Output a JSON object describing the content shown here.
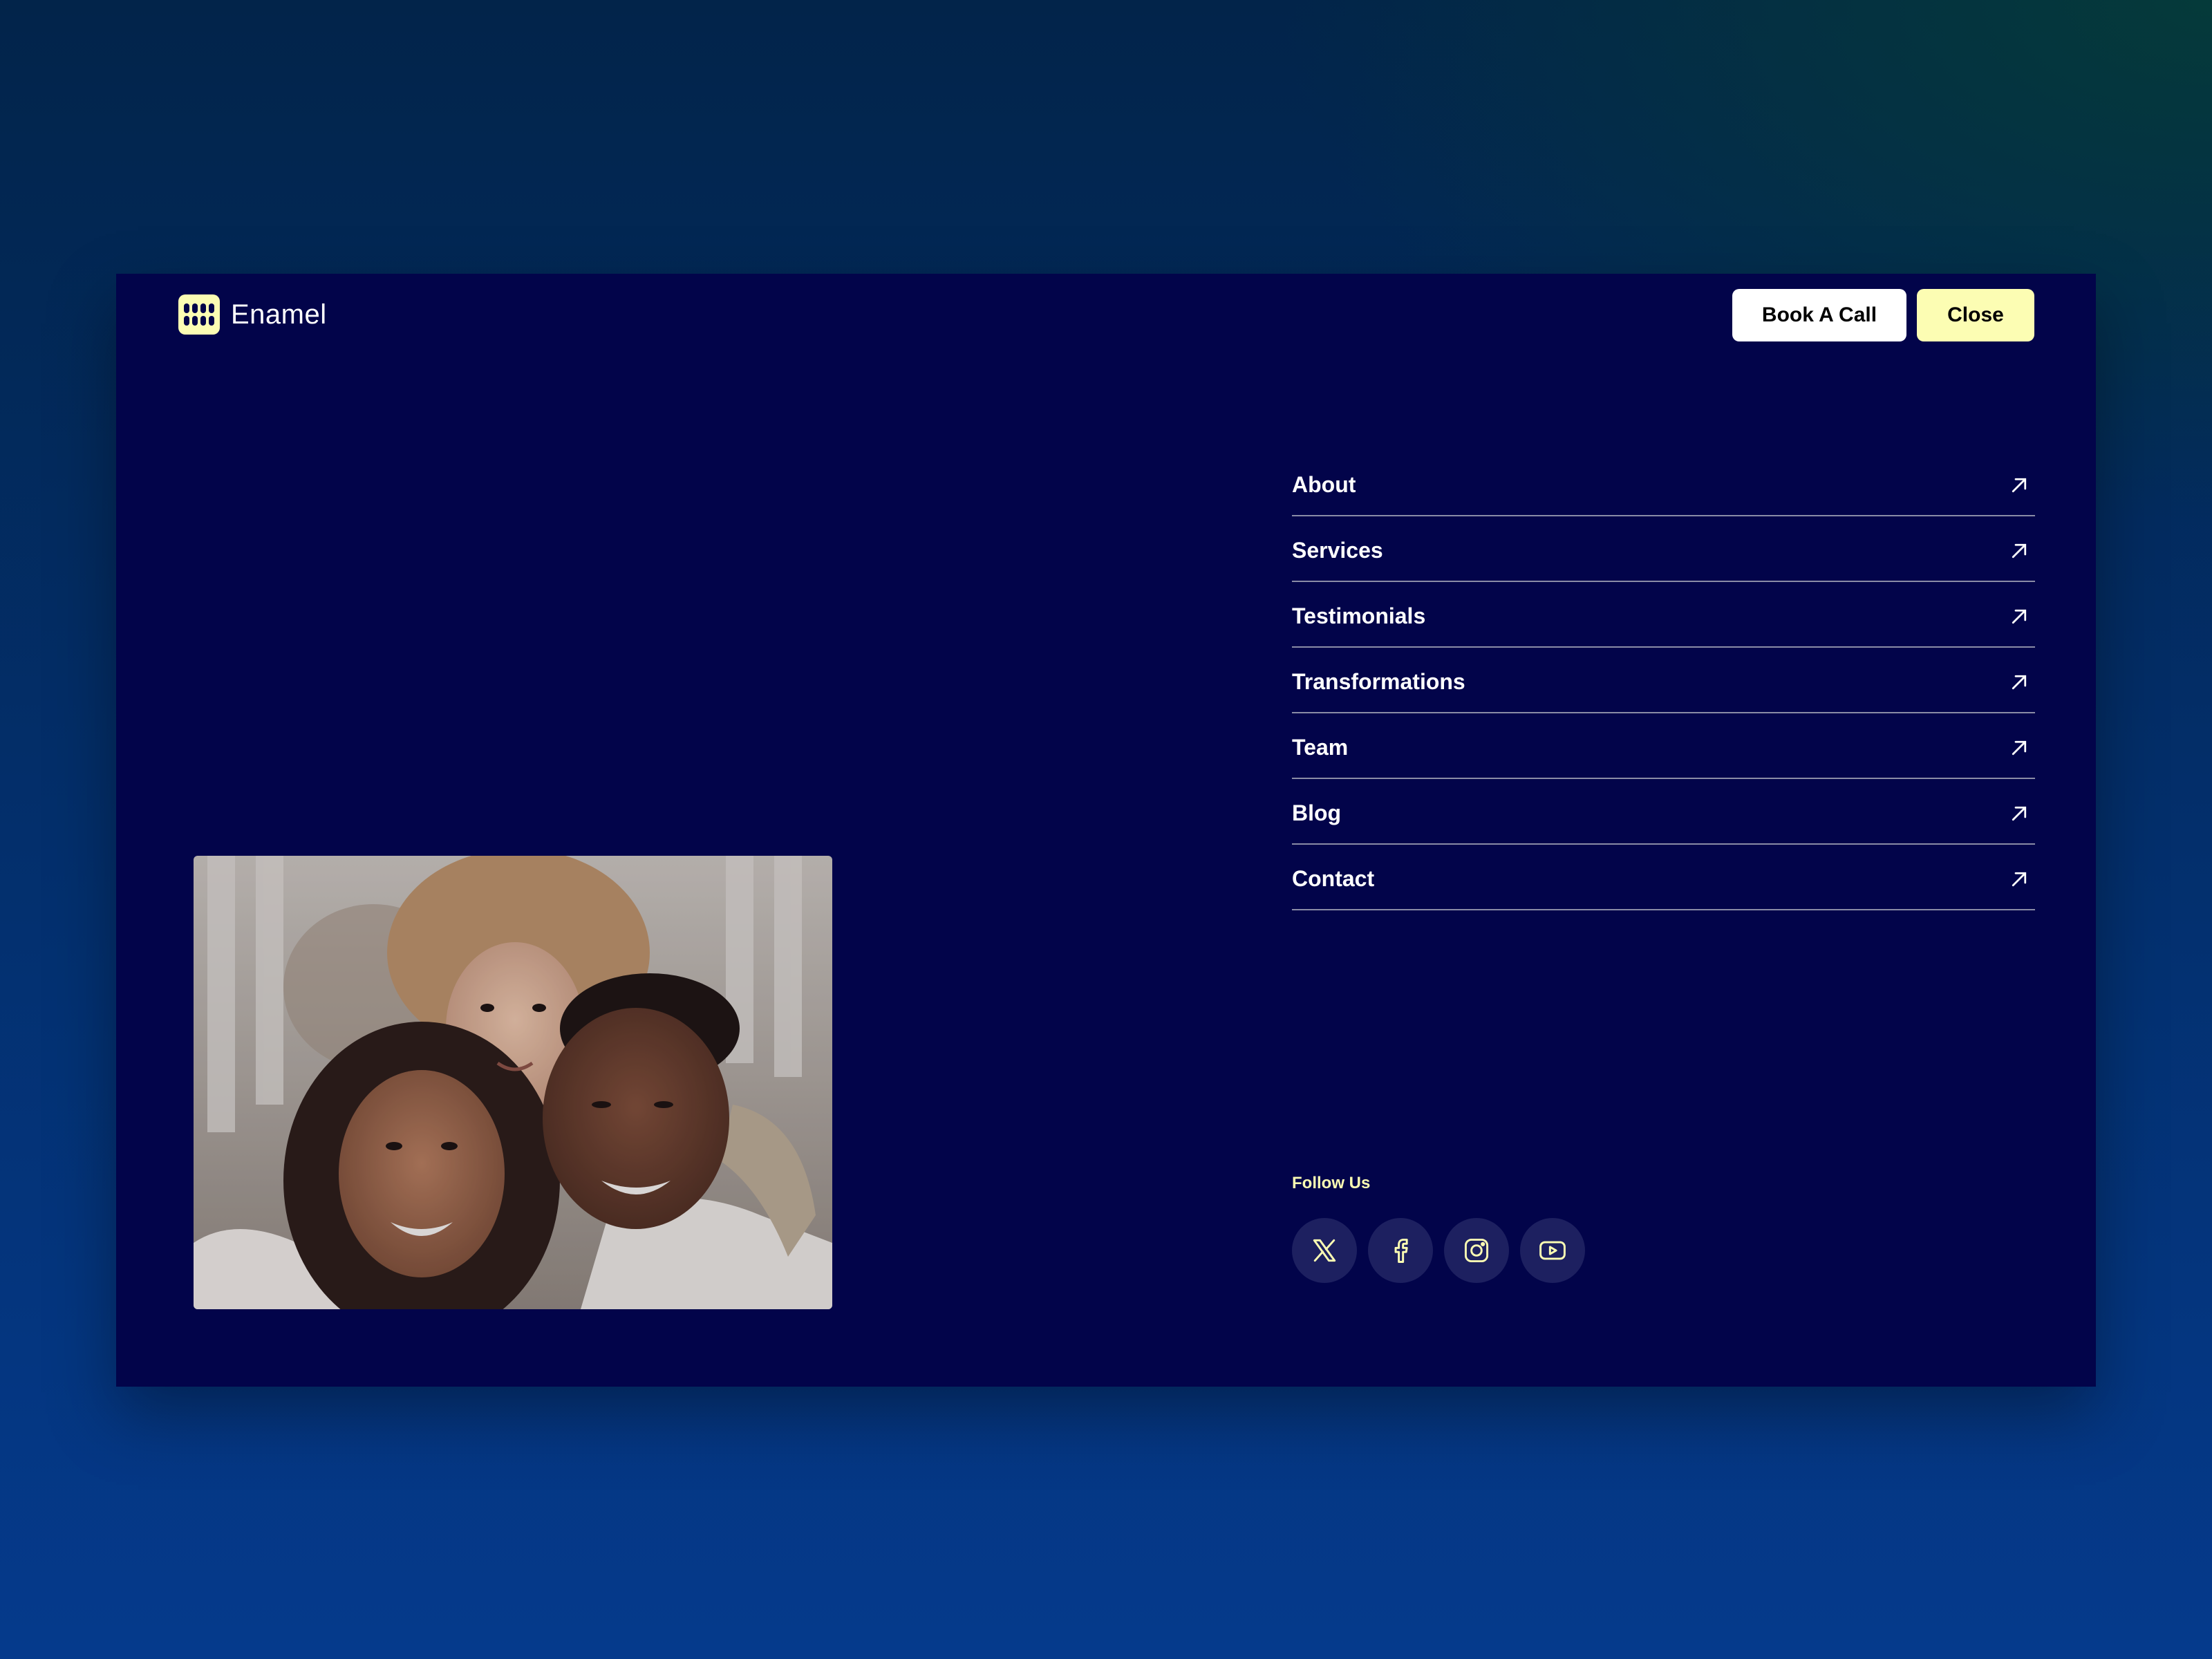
{
  "brand": {
    "name": "Enamel",
    "icon": "teeth-grid-icon"
  },
  "header": {
    "book_label": "Book A Call",
    "close_label": "Close"
  },
  "nav": {
    "items": [
      {
        "label": "About",
        "icon": "arrow-up-right-icon"
      },
      {
        "label": "Services",
        "icon": "arrow-up-right-icon"
      },
      {
        "label": "Testimonials",
        "icon": "arrow-up-right-icon"
      },
      {
        "label": "Transformations",
        "icon": "arrow-up-right-icon"
      },
      {
        "label": "Team",
        "icon": "arrow-up-right-icon"
      },
      {
        "label": "Blog",
        "icon": "arrow-up-right-icon"
      },
      {
        "label": "Contact",
        "icon": "arrow-up-right-icon"
      }
    ]
  },
  "social": {
    "heading": "Follow Us",
    "icons": [
      "x-icon",
      "facebook-icon",
      "instagram-icon",
      "youtube-icon"
    ]
  },
  "colors": {
    "panel_bg": "#02044a",
    "accent": "#fcfdb3",
    "text": "#ffffff"
  }
}
